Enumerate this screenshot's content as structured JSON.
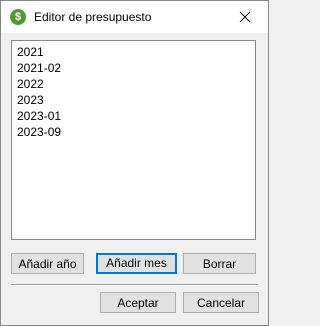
{
  "window": {
    "title": "Editor de presupuesto",
    "icon": "money-icon",
    "close_icon": "close-icon"
  },
  "list": {
    "items": [
      "2021",
      "2021-02",
      "2022",
      "2023",
      "2023-01",
      "2023-09"
    ]
  },
  "buttons": {
    "add_year": "Añadir año",
    "add_month": "Añadir mes",
    "delete": "Borrar",
    "accept": "Aceptar",
    "cancel": "Cancelar"
  },
  "colors": {
    "accent": "#0078d7",
    "icon_green": "#4e9a2c"
  }
}
